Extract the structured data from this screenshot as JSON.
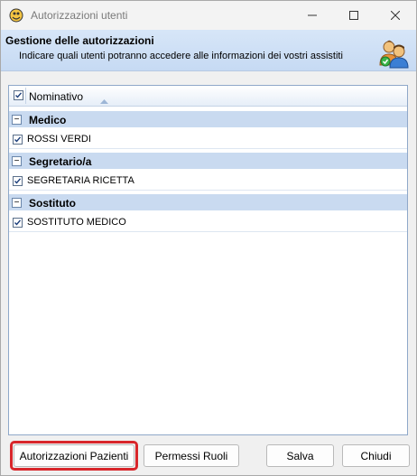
{
  "window": {
    "title": "Autorizzazioni utenti"
  },
  "header": {
    "title": "Gestione delle autorizzazioni",
    "subtitle": "Indicare quali utenti potranno accedere alle informazioni dei vostri assistiti"
  },
  "grid": {
    "column_header": "Nominativo",
    "groups": [
      {
        "label": "Medico",
        "rows": [
          {
            "label": "ROSSI VERDI",
            "checked": true
          }
        ]
      },
      {
        "label": "Segretario/a",
        "rows": [
          {
            "label": "SEGRETARIA RICETTA",
            "checked": true
          }
        ]
      },
      {
        "label": "Sostituto",
        "rows": [
          {
            "label": "SOSTITUTO MEDICO",
            "checked": true
          }
        ]
      }
    ],
    "group_toggle": "−"
  },
  "buttons": {
    "auth_patients": "Autorizzazioni Pazienti",
    "role_permissions": "Permessi Ruoli",
    "save": "Salva",
    "close": "Chiudi"
  },
  "colors": {
    "highlight": "#d8262b",
    "header_bg": "#c6daf3",
    "group_bg": "#c9daf0"
  }
}
